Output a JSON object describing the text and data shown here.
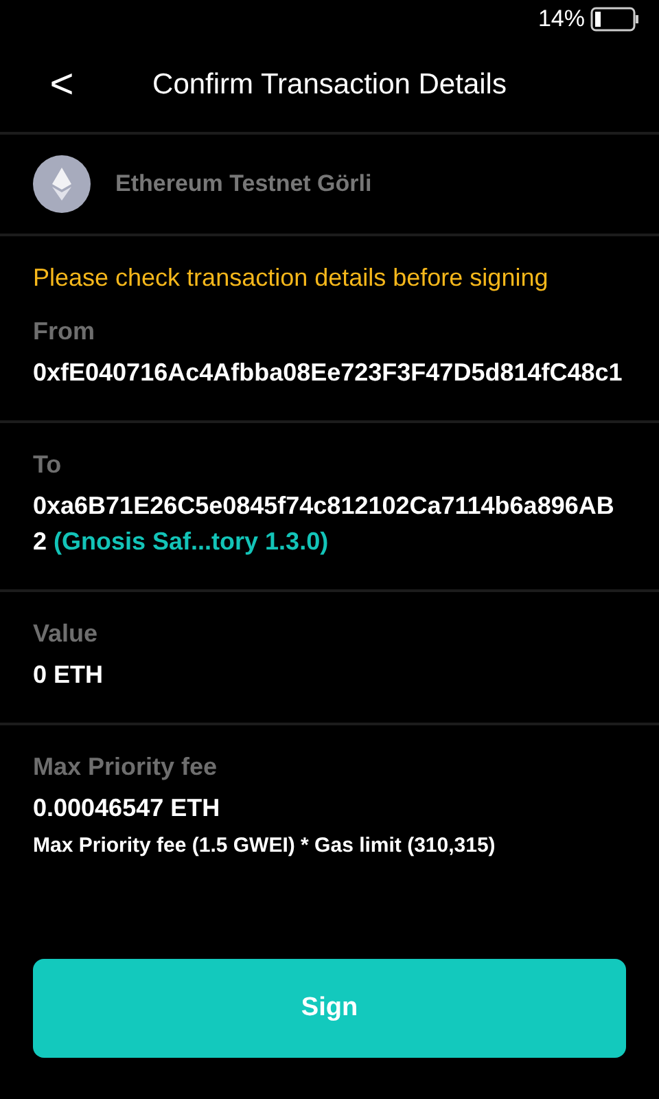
{
  "status_bar": {
    "battery": "14%"
  },
  "header": {
    "back": "<",
    "title": "Confirm Transaction Details"
  },
  "network": {
    "name": "Ethereum Testnet Görli"
  },
  "warning": "Please check transaction details before signing",
  "fields": [
    {
      "label": "From",
      "value": "0xfE040716Ac4Afbba08Ee723F3F47D5d814fC48c1"
    },
    {
      "label": "To",
      "value": "0xa6B71E26C5e0845f74c812102Ca7114b6a896AB2",
      "tag": "(Gnosis Saf...tory 1.3.0)"
    },
    {
      "label": "Value",
      "value": "0 ETH"
    },
    {
      "label": "Max Priority fee",
      "value": "0.00046547 ETH",
      "note": "Max Priority fee (1.5 GWEI) * Gas limit (310,315)"
    }
  ],
  "sign_button": "Sign"
}
